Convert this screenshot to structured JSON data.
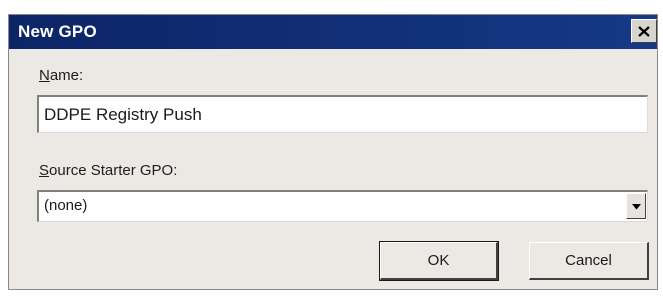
{
  "window": {
    "title": "New GPO",
    "close_icon": "close-icon"
  },
  "form": {
    "name_label_mnemonic": "N",
    "name_label_rest": "ame:",
    "name_value": "DDPE Registry Push",
    "source_label_mnemonic": "S",
    "source_label_rest": "ource Starter GPO:",
    "source_value": "(none)",
    "dropdown_icon": "chevron-down-icon"
  },
  "buttons": {
    "ok_label": "OK",
    "cancel_label": "Cancel"
  },
  "colors": {
    "titlebar": "#0f2a6b",
    "dialog_bg": "#ece9e4"
  }
}
